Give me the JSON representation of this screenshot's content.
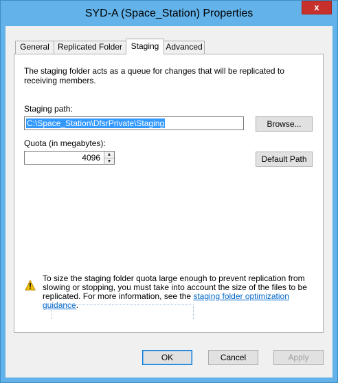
{
  "window": {
    "title": "SYD-A (Space_Station) Properties",
    "close_glyph": "x"
  },
  "tabs": [
    {
      "label": "General"
    },
    {
      "label": "Replicated Folder"
    },
    {
      "label": "Staging"
    },
    {
      "label": "Advanced"
    }
  ],
  "active_tab": "Staging",
  "staging": {
    "description": "The staging folder acts as a queue for changes that will be replicated to receiving members.",
    "path_label": "Staging path:",
    "path_value": "C:\\Space_Station\\DfsrPrivate\\Staging",
    "browse_label": "Browse...",
    "quota_label": "Quota (in megabytes):",
    "quota_value": "4096",
    "default_path_label": "Default Path"
  },
  "warning": {
    "icon": "warning-icon",
    "text": "To size the staging folder quota large enough to prevent replication from slowing or stopping, you must take into account the size of the files to be replicated. For more information, see the",
    "link_text": "staging folder optimization guidance",
    "link_suffix": "."
  },
  "buttons": {
    "ok": "OK",
    "cancel": "Cancel",
    "apply": "Apply"
  },
  "colors": {
    "titlebar": "#63b3ea",
    "close": "#c7302b",
    "selection": "#3399ff",
    "link": "#0066cc"
  }
}
